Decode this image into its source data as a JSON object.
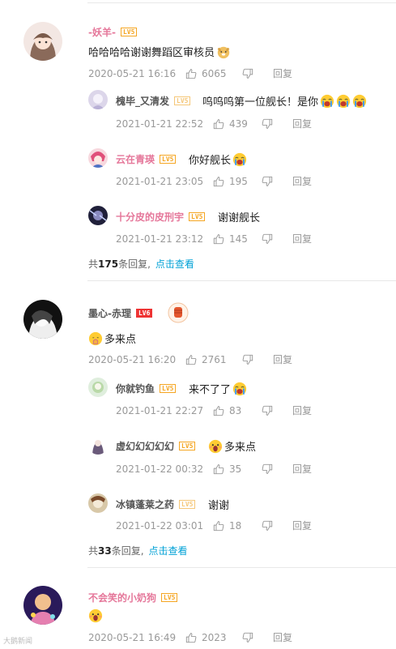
{
  "labels": {
    "reply": "回复"
  },
  "comments": [
    {
      "user": "-妖羊-",
      "level": "LV5",
      "text": "哈哈哈哈谢谢舞蹈区审核员",
      "time": "2020-05-21 16:16",
      "likes": "6065",
      "replies": [
        {
          "user": "槐毕_又清发",
          "level": "LV5",
          "text": "呜呜呜第一位舰长！是你",
          "time": "2021-01-21 22:52",
          "likes": "439"
        },
        {
          "user": "云在青瑛",
          "level": "LV5",
          "text": "你好舰长",
          "time": "2021-01-21 23:05",
          "likes": "195"
        },
        {
          "user": "十分皮的皮刑宇",
          "level": "LV5",
          "text": "谢谢舰长",
          "time": "2021-01-21 23:12",
          "likes": "145"
        }
      ],
      "more": {
        "prefix": "共",
        "count": "175",
        "suffix": "条回复,",
        "link": "点击查看"
      }
    },
    {
      "user": "墨心-赤理",
      "level": "LV6",
      "text": "多来点",
      "time": "2020-05-21 16:20",
      "likes": "2761",
      "replies": [
        {
          "user": "你就钓鱼",
          "level": "LV5",
          "text": "来不了了",
          "time": "2021-01-21 22:27",
          "likes": "83"
        },
        {
          "user": "虚幻幻幻幻幻",
          "level": "LV5",
          "text": "多来点",
          "time": "2021-01-22 00:32",
          "likes": "35"
        },
        {
          "user": "冰镇蓬莱之药",
          "level": "LV5",
          "text": "谢谢",
          "time": "2021-01-22 03:01",
          "likes": "18"
        }
      ],
      "more": {
        "prefix": "共",
        "count": "33",
        "suffix": "条回复,",
        "link": "点击查看"
      }
    },
    {
      "user": "不会笑的小奶狗",
      "level": "LV5",
      "text": "",
      "time": "2020-05-21 16:49",
      "likes": "2023"
    }
  ],
  "watermark": "大鹅新闻",
  "colors": {
    "name_pink": "#e5779a",
    "link_blue": "#00a1d6",
    "meta_gray": "#999999",
    "level_orange": "#f5a623"
  }
}
